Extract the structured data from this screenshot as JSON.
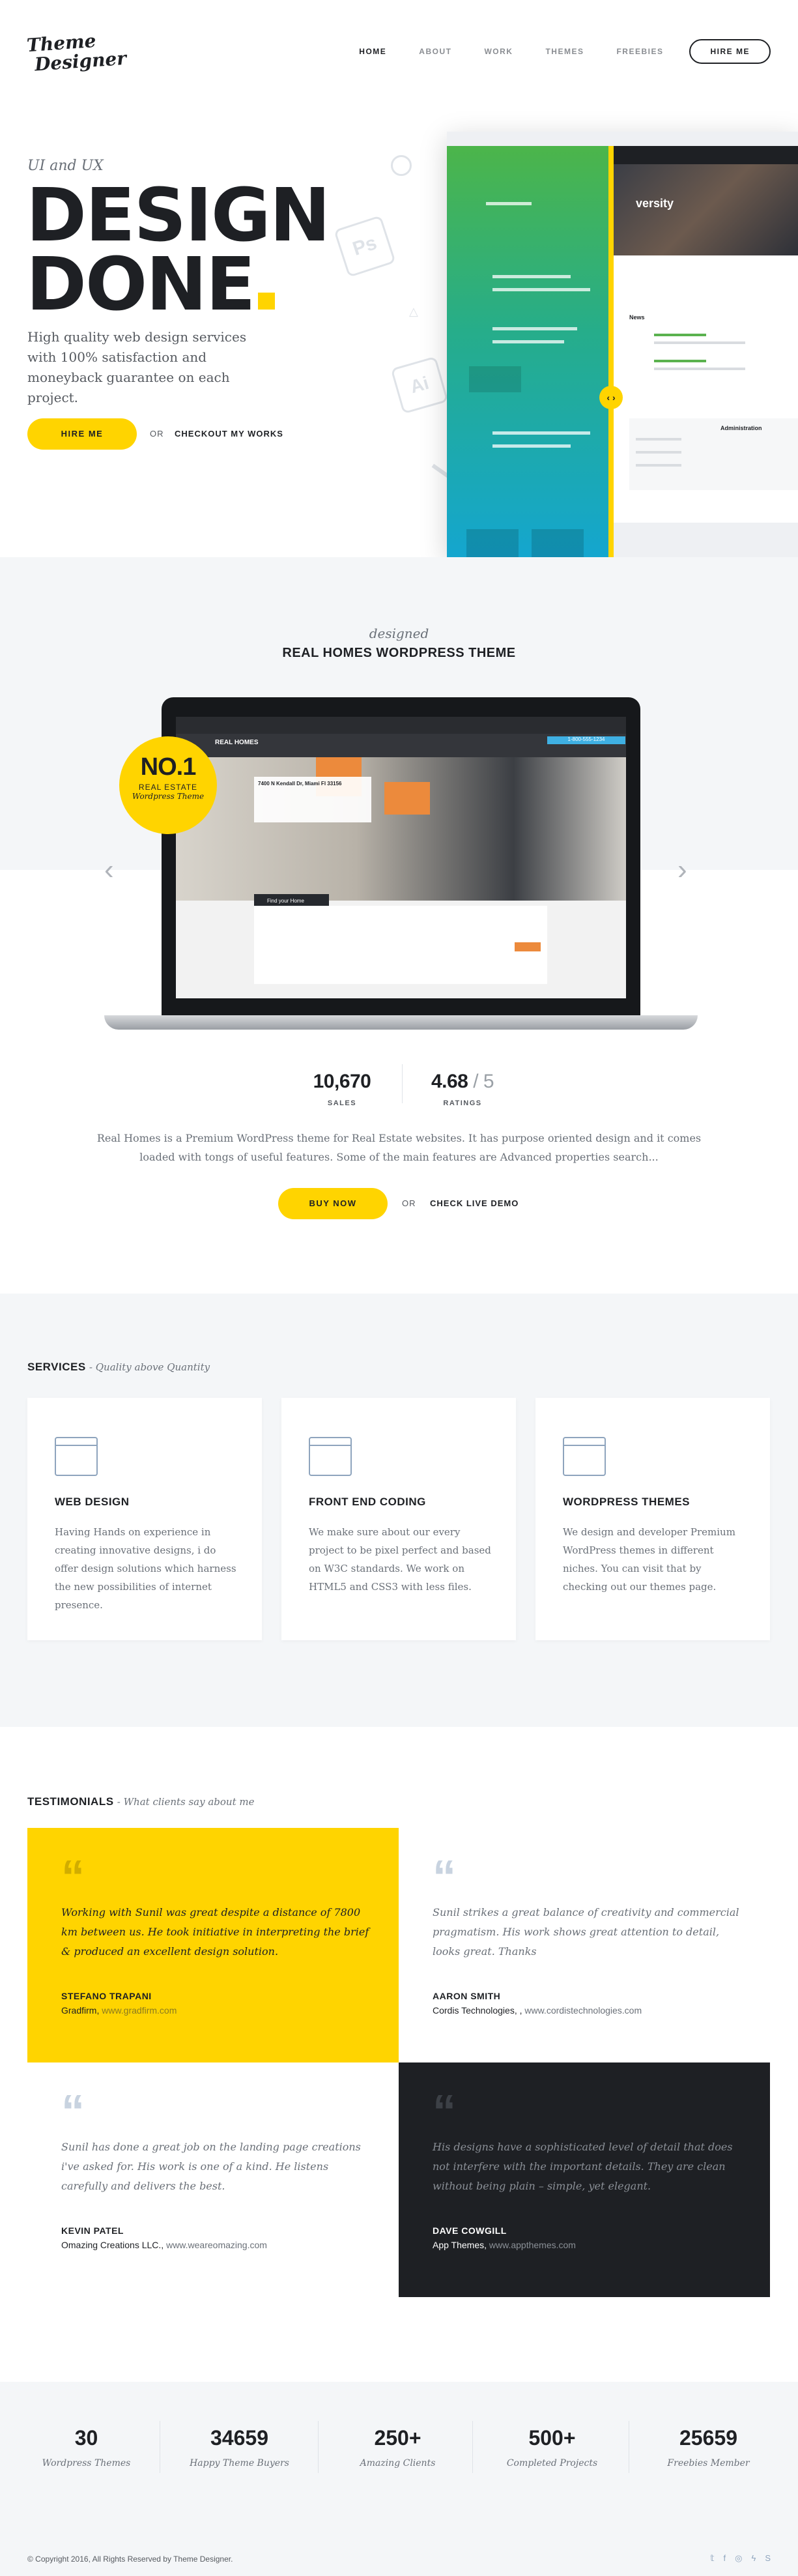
{
  "header": {
    "logo_line1": "Theme",
    "logo_line2": "Designer",
    "nav": [
      "HOME",
      "ABOUT",
      "WORK",
      "THEMES",
      "FREEBIES"
    ],
    "hire": "HIRE ME"
  },
  "hero": {
    "eyebrow": "UI and UX",
    "title_line1": "DESIGN",
    "title_line2": "DONE",
    "lead": "High quality web design services with 100% satisfaction and moneyback guarantee on each project.",
    "hire_btn": "HIRE ME",
    "or": "OR",
    "works_link": "CHECKOUT MY WORKS",
    "deco_ps": "Ps",
    "deco_ai": "Ai",
    "mock_heading": "versity",
    "mock_news": "News",
    "mock_admin": "Administration"
  },
  "product": {
    "designed": "designed",
    "title": "REAL HOMES WORDPRESS THEME",
    "badge_big": "NO.1",
    "badge_line1": "REAL ESTATE",
    "badge_line2": "Wordpress Theme",
    "screen_brand": "REAL HOMES",
    "screen_address": "7400 N Kendall Dr, Miami Fl 33156",
    "screen_find": "Find your Home",
    "screen_phone": "1-800-555-1234",
    "sales_value": "10,670",
    "sales_label": "SALES",
    "rating_value": "4.68",
    "rating_total": "/ 5",
    "rating_label": "RATINGS",
    "description": "Real Homes is a Premium WordPress theme for Real Estate websites. It has purpose oriented design and it comes loaded with tongs of useful features. Some of the main features are Advanced properties search...",
    "buy": "BUY NOW",
    "or": "OR",
    "demo": "CHECK LIVE DEMO"
  },
  "services": {
    "heading": "SERVICES",
    "sub": "- Quality above Quantity",
    "items": [
      {
        "title": "WEB DESIGN",
        "text": "Having Hands on experience in creating innovative designs, i do offer design solutions which harness the new possibilities of internet presence.",
        "icon": "web-design-icon"
      },
      {
        "title": "FRONT END CODING",
        "text": "We make sure about our every project to be pixel perfect and based on W3C standards. We work on HTML5 and CSS3 with less files.",
        "icon": "code-window-icon"
      },
      {
        "title": "WORDPRESS THEMES",
        "text": "We design and developer Premium WordPress themes in different niches. You can visit that by checking out our themes page.",
        "icon": "stacked-windows-icon"
      }
    ]
  },
  "testimonials": {
    "heading": "TESTIMONIALS",
    "sub": "- What clients say about me",
    "items": [
      {
        "quote": "Working with Sunil was great despite a distance of 7800 km between us. He took initiative in interpreting the brief & produced an excellent design solution.",
        "name": "STEFANO TRAPANI",
        "company": "Gradfirm,",
        "url": "www.gradfirm.com",
        "bg": "#ffd400"
      },
      {
        "quote": "Sunil strikes a great balance of creativity and commercial pragmatism. His work shows great attention to detail, looks great. Thanks",
        "name": "AARON SMITH",
        "company": "Cordis Technologies, ,",
        "url": "www.cordistechnologies.com",
        "bg": "#ffffff"
      },
      {
        "quote": "Sunil has done a great job on the landing page creations i've asked for. His work is one of a kind. He listens carefully and delivers the best.",
        "name": "KEVIN PATEL",
        "company": "Omazing Creations LLC.,",
        "url": "www.weareomazing.com",
        "bg": "#ffffff"
      },
      {
        "quote": "His designs have a sophisticated level of detail that does not interfere with the important details. They are clean without being plain – simple, yet elegant.",
        "name": "DAVE COWGILL",
        "company": "App Themes,",
        "url": "www.appthemes.com",
        "bg": "#1e2024"
      }
    ]
  },
  "counters": [
    {
      "value": "30",
      "label": "Wordpress Themes"
    },
    {
      "value": "34659",
      "label": "Happy Theme Buyers"
    },
    {
      "value": "250+",
      "label": "Amazing Clients"
    },
    {
      "value": "500+",
      "label": "Completed Projects"
    },
    {
      "value": "25659",
      "label": "Freebies Member"
    }
  ],
  "footer": {
    "copyright": "© Copyright 2016, All Rights Reserved by Theme Designer.",
    "social": [
      "twitter-icon",
      "facebook-icon",
      "dribbble-icon",
      "flash-icon",
      "skype-icon"
    ]
  },
  "colors": {
    "accent": "#ffd400",
    "dark": "#1e2024",
    "muted": "#6a7078",
    "band": "#f4f6f8"
  }
}
